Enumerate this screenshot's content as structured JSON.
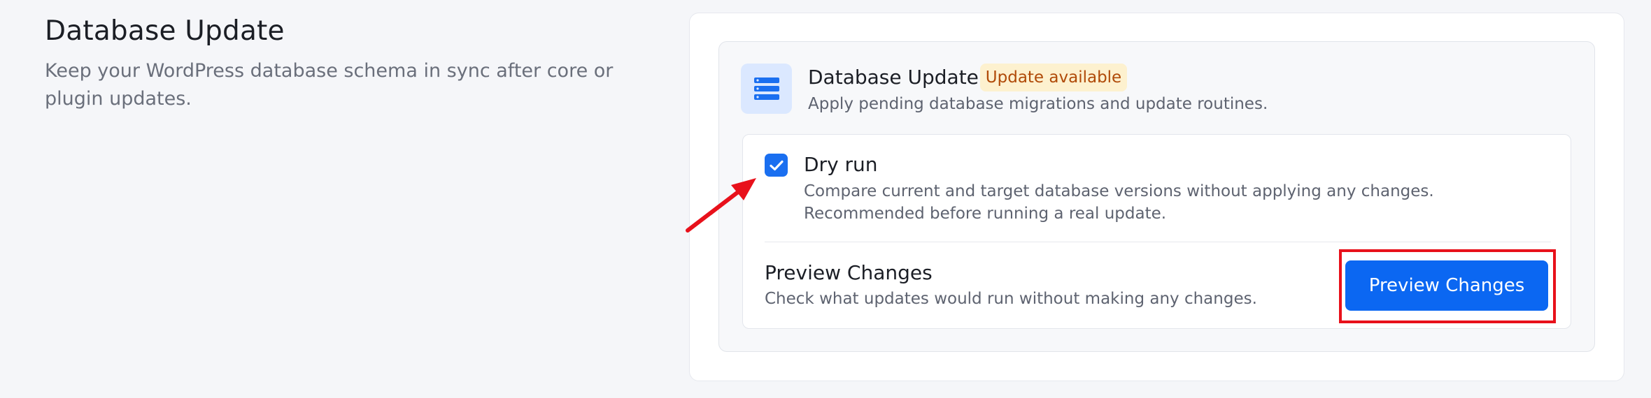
{
  "section": {
    "title": "Database Update",
    "description": "Keep your WordPress database schema in sync after core or plugin updates."
  },
  "card": {
    "icon": "database-icon",
    "title": "Database Update",
    "badge": "Update available",
    "description": "Apply pending database migrations and update routines."
  },
  "dry_run": {
    "checked": true,
    "label": "Dry run",
    "description": "Compare current and target database versions without applying any changes. Recommended before running a real update."
  },
  "preview": {
    "title": "Preview Changes",
    "description": "Check what updates would run without making any changes.",
    "button_label": "Preview Changes"
  },
  "colors": {
    "accent": "#0b67f2",
    "badge_bg": "#fdf1cf",
    "badge_text": "#b04a08",
    "annotation": "#e8111b"
  }
}
